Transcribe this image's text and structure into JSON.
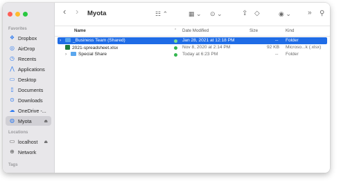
{
  "window": {
    "title": "Myota"
  },
  "toolbar": {
    "back": "‹",
    "forward": "›",
    "list_view": "☷ ⌃",
    "grid_view": "▦ ⌄",
    "more": "⊙ ⌄",
    "share": "⇪",
    "tag": "◇",
    "actions": "◉ ⌄",
    "overflow": "»",
    "search": "⚲"
  },
  "sidebar": {
    "favorites_heading": "Favorites",
    "favorites": [
      {
        "label": "Dropbox",
        "icon": "❖"
      },
      {
        "label": "AirDrop",
        "icon": "◎"
      },
      {
        "label": "Recents",
        "icon": "◷"
      },
      {
        "label": "Applications",
        "icon": "⋀"
      },
      {
        "label": "Desktop",
        "icon": "▭"
      },
      {
        "label": "Documents",
        "icon": "▯"
      },
      {
        "label": "Downloads",
        "icon": "⊙"
      },
      {
        "label": "OneDrive -...",
        "icon": "☁"
      },
      {
        "label": "Myota",
        "icon": "◍"
      }
    ],
    "locations_heading": "Locations",
    "locations": [
      {
        "label": "localhost",
        "icon": "▭"
      },
      {
        "label": "Network",
        "icon": "⊕"
      }
    ],
    "tags_heading": "Tags"
  },
  "columns": {
    "name": "Name",
    "date_modified": "Date Modified",
    "size": "Size",
    "kind": "Kind"
  },
  "files": [
    {
      "name": "_Business Team (Shared)",
      "date": "Jan 28, 2021 at 12:18 PM",
      "size": "--",
      "kind": "Folder",
      "type": "folder",
      "selected": true
    },
    {
      "name": "2021-spreadsheet.xlsx",
      "date": "Nov 8, 2020 at 2:14 PM",
      "size": "92 KB",
      "kind": "Microso...k (.xlsx)",
      "type": "xlsx",
      "selected": false
    },
    {
      "name": "Special Share",
      "date": "Today at 6:23 PM",
      "size": "--",
      "kind": "Folder",
      "type": "folder",
      "selected": false
    }
  ],
  "colors": {
    "close": "#fe5f57",
    "minimize": "#febc2e",
    "zoom": "#28c840",
    "selection": "#1f6ce6",
    "sync_ok": "#33b64f"
  }
}
